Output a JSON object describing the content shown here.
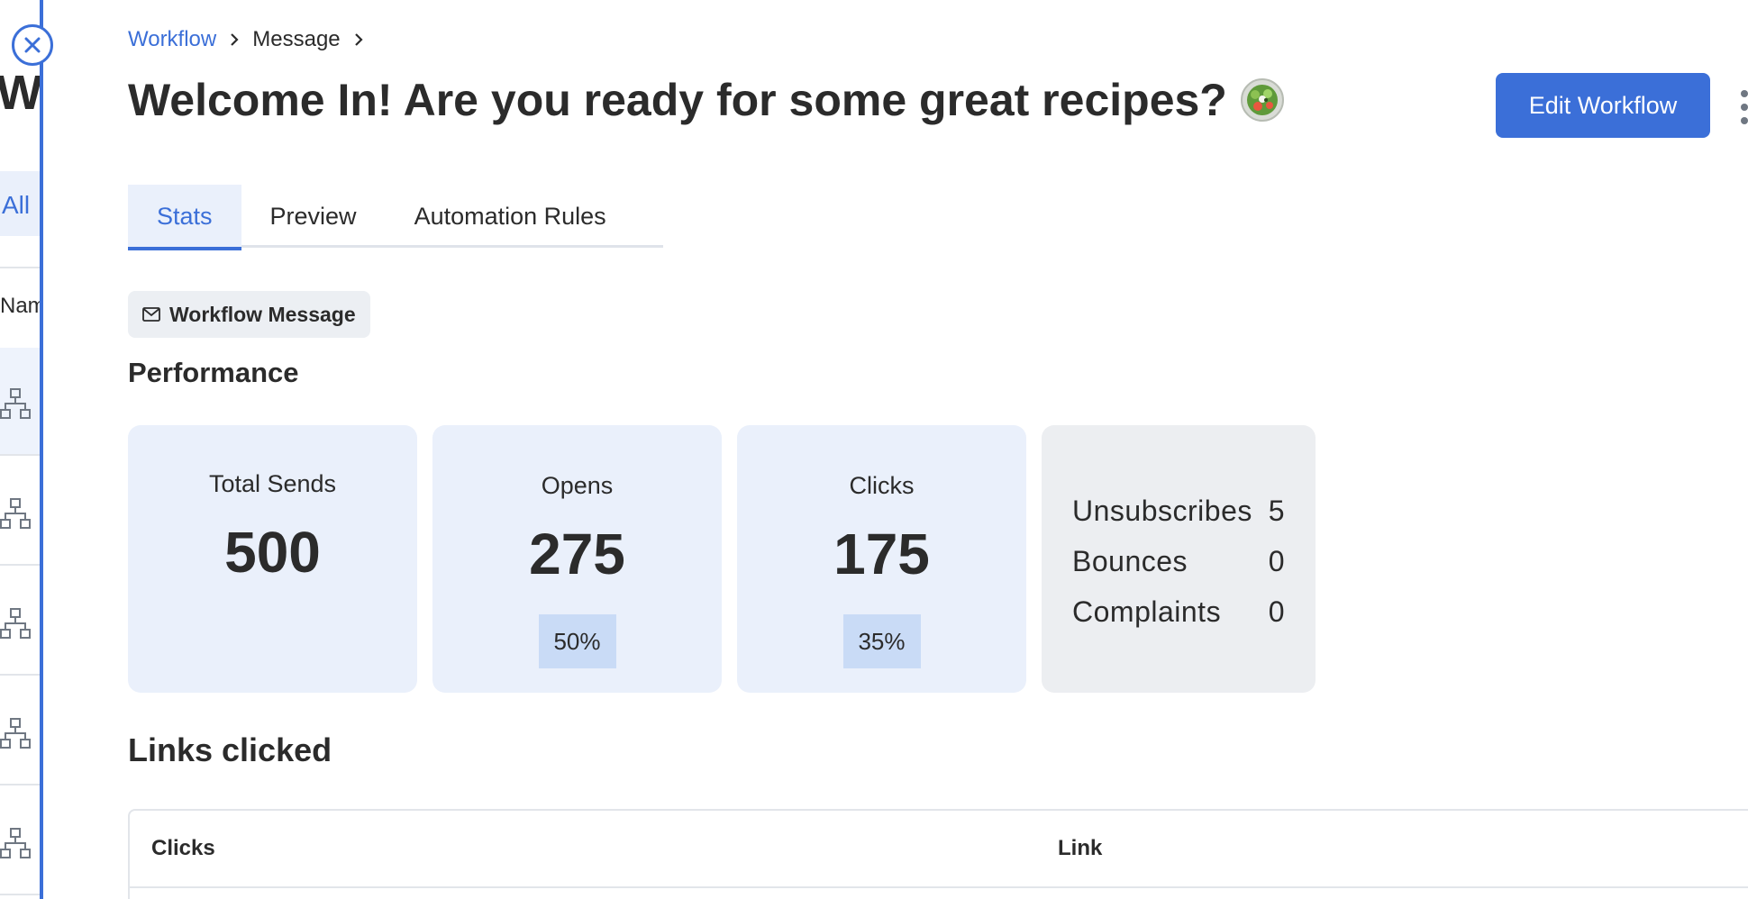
{
  "background_page": {
    "title_fragment": "Wo",
    "tab_fragment": "All",
    "column_fragment": "Nam"
  },
  "breadcrumb": {
    "items": [
      "Workflow",
      "Message"
    ]
  },
  "page": {
    "title": "Welcome In! Are you ready for some great recipes?",
    "title_emoji_icon": "salad-bowl-icon"
  },
  "actions": {
    "edit_label": "Edit Workflow",
    "more_icon": "kebab-menu-icon"
  },
  "tabs": [
    {
      "label": "Stats",
      "active": true
    },
    {
      "label": "Preview",
      "active": false
    },
    {
      "label": "Automation Rules",
      "active": false
    }
  ],
  "message_badge": {
    "icon": "envelope-icon",
    "label": "Workflow Message"
  },
  "performance": {
    "title": "Performance",
    "total_sends": {
      "label": "Total Sends",
      "value": "500"
    },
    "opens": {
      "label": "Opens",
      "value": "275",
      "percent": "50%"
    },
    "clicks": {
      "label": "Clicks",
      "value": "175",
      "percent": "35%"
    },
    "other": [
      {
        "label": "Unsubscribes",
        "value": "5"
      },
      {
        "label": "Bounces",
        "value": "0"
      },
      {
        "label": "Complaints",
        "value": "0"
      }
    ]
  },
  "links_clicked": {
    "title": "Links clicked",
    "columns": [
      "Clicks",
      "Link"
    ]
  },
  "colors": {
    "accent": "#3b6fd8",
    "card_bg": "#eaf0fb",
    "percent_bg": "#c9dbf6",
    "neutral_card_bg": "#eceef1"
  }
}
